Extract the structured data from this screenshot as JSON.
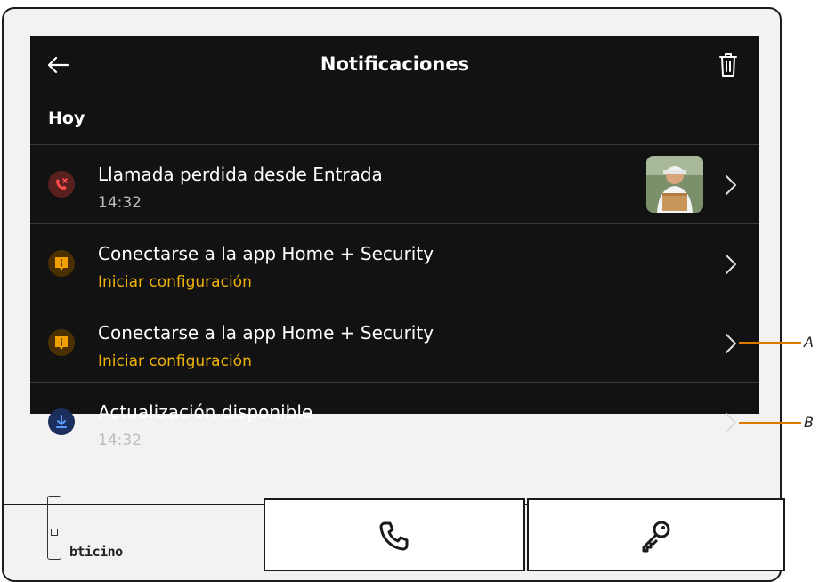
{
  "header": {
    "title": "Notificaciones"
  },
  "section": {
    "label": "Hoy"
  },
  "notifications": [
    {
      "title": "Llamada perdida desde Entrada",
      "subtitle": "14:32",
      "icon": "missed-call-icon",
      "icon_color": "#c0392b"
    },
    {
      "title": "Conectarse a la app Home + Security",
      "subtitle": "Iniciar configuración",
      "icon": "info-alert-icon",
      "icon_color": "#f0b30a"
    },
    {
      "title": "Conectarse a la app Home + Security",
      "subtitle": "Iniciar configuración",
      "icon": "info-alert-icon",
      "icon_color": "#f0b30a"
    },
    {
      "title": "Actualización disponible",
      "subtitle": "14:32",
      "icon": "download-icon",
      "icon_color": "#2f6fe0"
    }
  ],
  "annotations": {
    "a": "A",
    "b": "B"
  },
  "brand": {
    "logo_text": "bticino"
  },
  "controls": {
    "call_icon": "phone-icon",
    "key_icon": "key-icon"
  },
  "colors": {
    "screen_bg": "#121212",
    "accent": "#f0b30a"
  }
}
